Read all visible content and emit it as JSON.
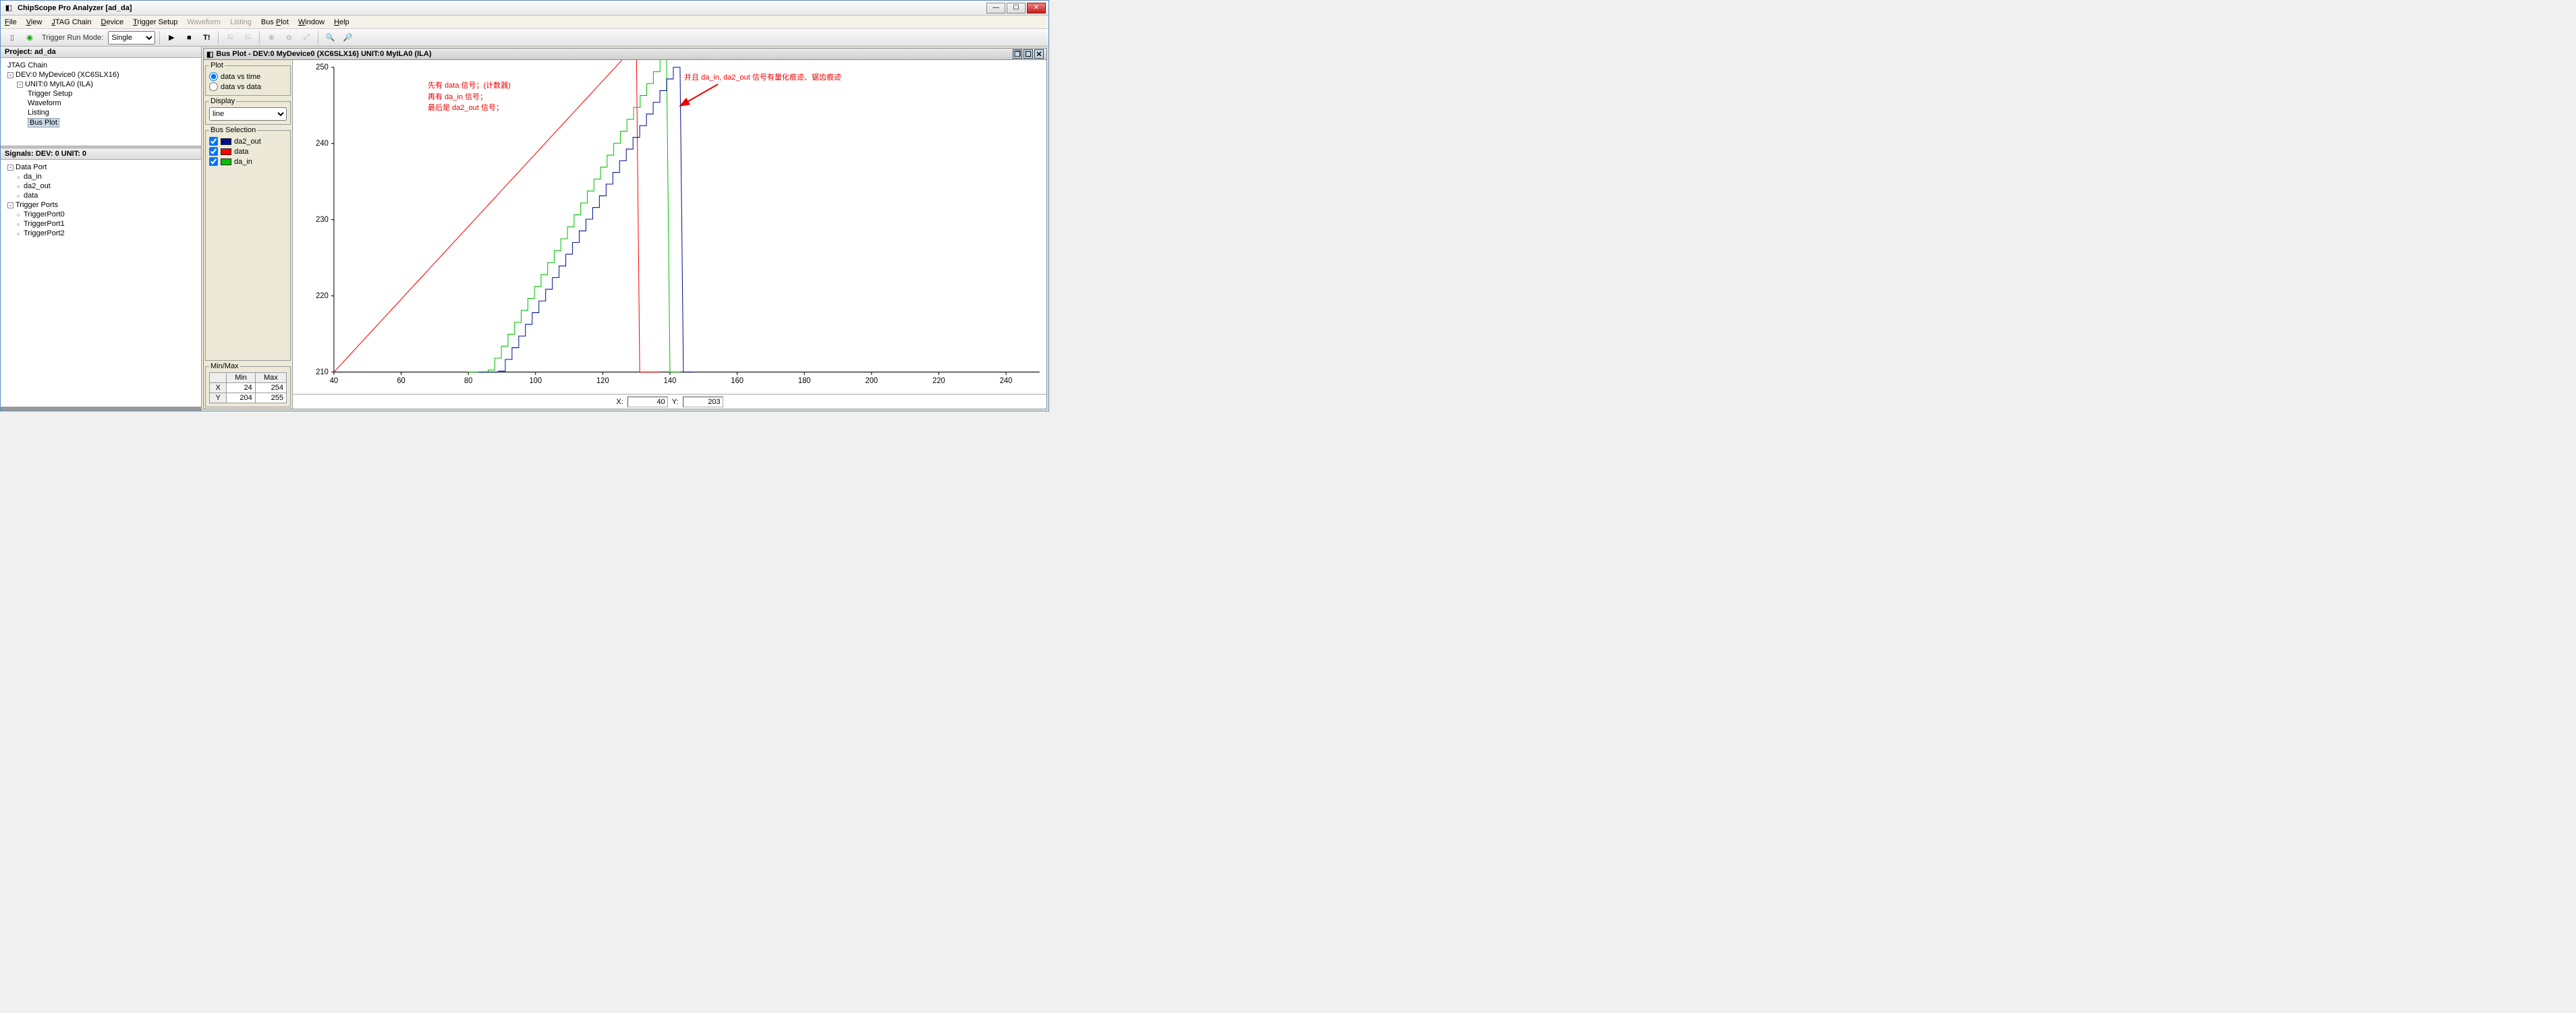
{
  "window": {
    "title": "ChipScope Pro Analyzer [ad_da]"
  },
  "menu": {
    "file": "File",
    "view": "View",
    "jtag": "JTAG Chain",
    "device": "Device",
    "trigger": "Trigger Setup",
    "waveform": "Waveform",
    "listing": "Listing",
    "busplot": "Bus Plot",
    "window": "Window",
    "help": "Help"
  },
  "toolbar": {
    "trigger_run_mode_label": "Trigger Run Mode:",
    "trigger_run_mode_value": "Single"
  },
  "project_panel": {
    "title": "Project: ad_da",
    "jtag_chain": "JTAG Chain",
    "device": "DEV:0 MyDevice0 (XC6SLX16)",
    "unit": "UNIT:0 MyILA0 (ILA)",
    "items": {
      "trigger_setup": "Trigger Setup",
      "waveform": "Waveform",
      "listing": "Listing",
      "bus_plot": "Bus Plot"
    }
  },
  "signals_panel": {
    "title": "Signals: DEV: 0 UNIT: 0",
    "data_port": "Data Port",
    "signals": {
      "da_in": "da_in",
      "da2_out": "da2_out",
      "data": "data"
    },
    "trigger_ports": "Trigger Ports",
    "ports": {
      "tp0": "TriggerPort0",
      "tp1": "TriggerPort1",
      "tp2": "TriggerPort2"
    }
  },
  "busplot": {
    "title": "Bus Plot - DEV:0 MyDevice0 (XC6SLX16) UNIT:0 MyILA0 (ILA)",
    "plot_group": "Plot",
    "opt_dvt": "data vs time",
    "opt_dvd": "data vs data",
    "display_group": "Display",
    "display_value": "line",
    "bus_sel_group": "Bus Selection",
    "bus": {
      "da2_out": "da2_out",
      "data": "data",
      "da_in": "da_in"
    },
    "minmax_group": "Min/Max",
    "minmax": {
      "min_h": "Min",
      "max_h": "Max",
      "x_label": "X",
      "y_label": "Y",
      "x_min": "24",
      "x_max": "254",
      "y_min": "204",
      "y_max": "255"
    },
    "cursor": {
      "x_label": "X:",
      "y_label": "Y:",
      "x_val": "40",
      "y_val": "203"
    }
  },
  "annotations": {
    "left_l1": "先有 data 信号；(计数器)",
    "left_l2": "再有 da_in 信号；",
    "left_l3": "最后是 da2_out 信号；",
    "right": "并且 da_in, da2_out 信号有量化痕迹、锯齿痕迹"
  },
  "chart_data": {
    "type": "line",
    "xlabel": "",
    "ylabel": "",
    "xlim": [
      40,
      250
    ],
    "ylim": [
      210,
      250
    ],
    "x_ticks": [
      40,
      60,
      80,
      100,
      120,
      140,
      160,
      180,
      200,
      220,
      240
    ],
    "y_ticks": [
      210,
      220,
      230,
      240,
      250
    ],
    "series": [
      {
        "name": "data",
        "color": "#ff0000",
        "style": "line",
        "approx_points": [
          [
            40,
            204
          ],
          [
            130,
            253
          ],
          [
            131,
            204
          ],
          [
            135,
            206
          ]
        ]
      },
      {
        "name": "da_in",
        "color": "#00c000",
        "style": "step",
        "approx_points": [
          [
            80,
            204
          ],
          [
            139,
            251
          ],
          [
            140,
            204
          ],
          [
            141,
            204
          ]
        ]
      },
      {
        "name": "da2_out",
        "color": "#001090",
        "style": "step",
        "approx_points": [
          [
            83,
            204
          ],
          [
            143,
            250
          ],
          [
            144,
            204
          ],
          [
            145,
            204
          ]
        ]
      }
    ],
    "title": ""
  }
}
